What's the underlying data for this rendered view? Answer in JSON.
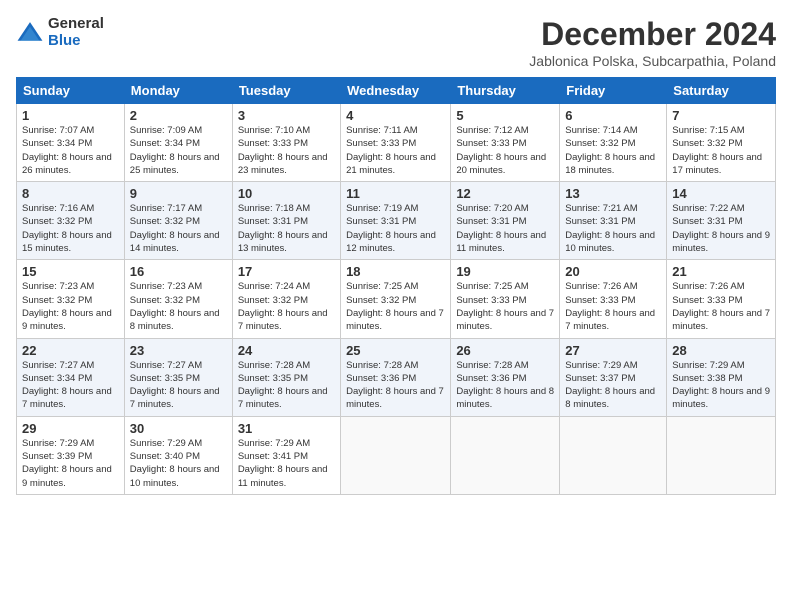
{
  "logo": {
    "general": "General",
    "blue": "Blue"
  },
  "header": {
    "month": "December 2024",
    "location": "Jablonica Polska, Subcarpathia, Poland"
  },
  "weekdays": [
    "Sunday",
    "Monday",
    "Tuesday",
    "Wednesday",
    "Thursday",
    "Friday",
    "Saturday"
  ],
  "weeks": [
    [
      {
        "day": "1",
        "sunrise": "7:07 AM",
        "sunset": "3:34 PM",
        "daylight": "8 hours and 26 minutes."
      },
      {
        "day": "2",
        "sunrise": "7:09 AM",
        "sunset": "3:34 PM",
        "daylight": "8 hours and 25 minutes."
      },
      {
        "day": "3",
        "sunrise": "7:10 AM",
        "sunset": "3:33 PM",
        "daylight": "8 hours and 23 minutes."
      },
      {
        "day": "4",
        "sunrise": "7:11 AM",
        "sunset": "3:33 PM",
        "daylight": "8 hours and 21 minutes."
      },
      {
        "day": "5",
        "sunrise": "7:12 AM",
        "sunset": "3:33 PM",
        "daylight": "8 hours and 20 minutes."
      },
      {
        "day": "6",
        "sunrise": "7:14 AM",
        "sunset": "3:32 PM",
        "daylight": "8 hours and 18 minutes."
      },
      {
        "day": "7",
        "sunrise": "7:15 AM",
        "sunset": "3:32 PM",
        "daylight": "8 hours and 17 minutes."
      }
    ],
    [
      {
        "day": "8",
        "sunrise": "7:16 AM",
        "sunset": "3:32 PM",
        "daylight": "8 hours and 15 minutes."
      },
      {
        "day": "9",
        "sunrise": "7:17 AM",
        "sunset": "3:32 PM",
        "daylight": "8 hours and 14 minutes."
      },
      {
        "day": "10",
        "sunrise": "7:18 AM",
        "sunset": "3:31 PM",
        "daylight": "8 hours and 13 minutes."
      },
      {
        "day": "11",
        "sunrise": "7:19 AM",
        "sunset": "3:31 PM",
        "daylight": "8 hours and 12 minutes."
      },
      {
        "day": "12",
        "sunrise": "7:20 AM",
        "sunset": "3:31 PM",
        "daylight": "8 hours and 11 minutes."
      },
      {
        "day": "13",
        "sunrise": "7:21 AM",
        "sunset": "3:31 PM",
        "daylight": "8 hours and 10 minutes."
      },
      {
        "day": "14",
        "sunrise": "7:22 AM",
        "sunset": "3:31 PM",
        "daylight": "8 hours and 9 minutes."
      }
    ],
    [
      {
        "day": "15",
        "sunrise": "7:23 AM",
        "sunset": "3:32 PM",
        "daylight": "8 hours and 9 minutes."
      },
      {
        "day": "16",
        "sunrise": "7:23 AM",
        "sunset": "3:32 PM",
        "daylight": "8 hours and 8 minutes."
      },
      {
        "day": "17",
        "sunrise": "7:24 AM",
        "sunset": "3:32 PM",
        "daylight": "8 hours and 7 minutes."
      },
      {
        "day": "18",
        "sunrise": "7:25 AM",
        "sunset": "3:32 PM",
        "daylight": "8 hours and 7 minutes."
      },
      {
        "day": "19",
        "sunrise": "7:25 AM",
        "sunset": "3:33 PM",
        "daylight": "8 hours and 7 minutes."
      },
      {
        "day": "20",
        "sunrise": "7:26 AM",
        "sunset": "3:33 PM",
        "daylight": "8 hours and 7 minutes."
      },
      {
        "day": "21",
        "sunrise": "7:26 AM",
        "sunset": "3:33 PM",
        "daylight": "8 hours and 7 minutes."
      }
    ],
    [
      {
        "day": "22",
        "sunrise": "7:27 AM",
        "sunset": "3:34 PM",
        "daylight": "8 hours and 7 minutes."
      },
      {
        "day": "23",
        "sunrise": "7:27 AM",
        "sunset": "3:35 PM",
        "daylight": "8 hours and 7 minutes."
      },
      {
        "day": "24",
        "sunrise": "7:28 AM",
        "sunset": "3:35 PM",
        "daylight": "8 hours and 7 minutes."
      },
      {
        "day": "25",
        "sunrise": "7:28 AM",
        "sunset": "3:36 PM",
        "daylight": "8 hours and 7 minutes."
      },
      {
        "day": "26",
        "sunrise": "7:28 AM",
        "sunset": "3:36 PM",
        "daylight": "8 hours and 8 minutes."
      },
      {
        "day": "27",
        "sunrise": "7:29 AM",
        "sunset": "3:37 PM",
        "daylight": "8 hours and 8 minutes."
      },
      {
        "day": "28",
        "sunrise": "7:29 AM",
        "sunset": "3:38 PM",
        "daylight": "8 hours and 9 minutes."
      }
    ],
    [
      {
        "day": "29",
        "sunrise": "7:29 AM",
        "sunset": "3:39 PM",
        "daylight": "8 hours and 9 minutes."
      },
      {
        "day": "30",
        "sunrise": "7:29 AM",
        "sunset": "3:40 PM",
        "daylight": "8 hours and 10 minutes."
      },
      {
        "day": "31",
        "sunrise": "7:29 AM",
        "sunset": "3:41 PM",
        "daylight": "8 hours and 11 minutes."
      },
      null,
      null,
      null,
      null
    ]
  ]
}
